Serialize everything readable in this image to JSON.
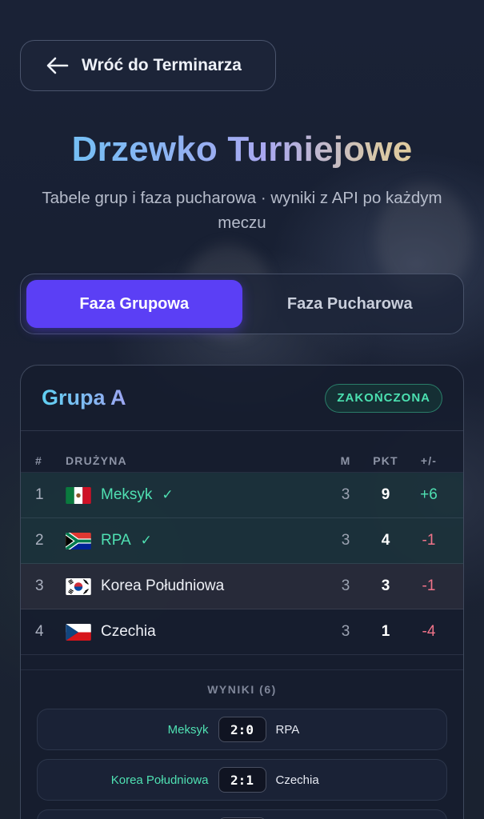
{
  "back_button": {
    "label": "Wróć do Terminarza"
  },
  "header": {
    "title": "Drzewko Turniejowe",
    "subtitle": "Tabele grup i faza pucharowa · wyniki z API po każdym meczu"
  },
  "tabs": [
    {
      "label": "Faza Grupowa",
      "active": true
    },
    {
      "label": "Faza Pucharowa",
      "active": false
    }
  ],
  "group": {
    "name": "Grupa A",
    "status": "ZAKOŃCZONA",
    "columns": {
      "pos": "#",
      "team": "DRUŻYNA",
      "m": "M",
      "pts": "PKT",
      "diff": "+/-"
    },
    "rows": [
      {
        "pos": "1",
        "team": "Meksyk",
        "check": "✓",
        "m": "3",
        "pts": "9",
        "diff": "+6",
        "flag": "mexico-flag"
      },
      {
        "pos": "2",
        "team": "RPA",
        "check": "✓",
        "m": "3",
        "pts": "4",
        "diff": "-1",
        "flag": "south-africa-flag"
      },
      {
        "pos": "3",
        "team": "Korea Południowa",
        "m": "3",
        "pts": "3",
        "diff": "-1",
        "flag": "south-korea-flag"
      },
      {
        "pos": "4",
        "team": "Czechia",
        "m": "3",
        "pts": "1",
        "diff": "-4",
        "flag": "czechia-flag"
      }
    ]
  },
  "results": {
    "label": "WYNIKI (6)",
    "matches": [
      {
        "home": "Meksyk",
        "score": "2:0",
        "away": "RPA"
      },
      {
        "home": "Korea Południowa",
        "score": "2:1",
        "away": "Czechia"
      }
    ]
  },
  "colors": {
    "accent": "#5b3ff5",
    "qualified": "#4fe0b2",
    "negative": "#f07389"
  }
}
